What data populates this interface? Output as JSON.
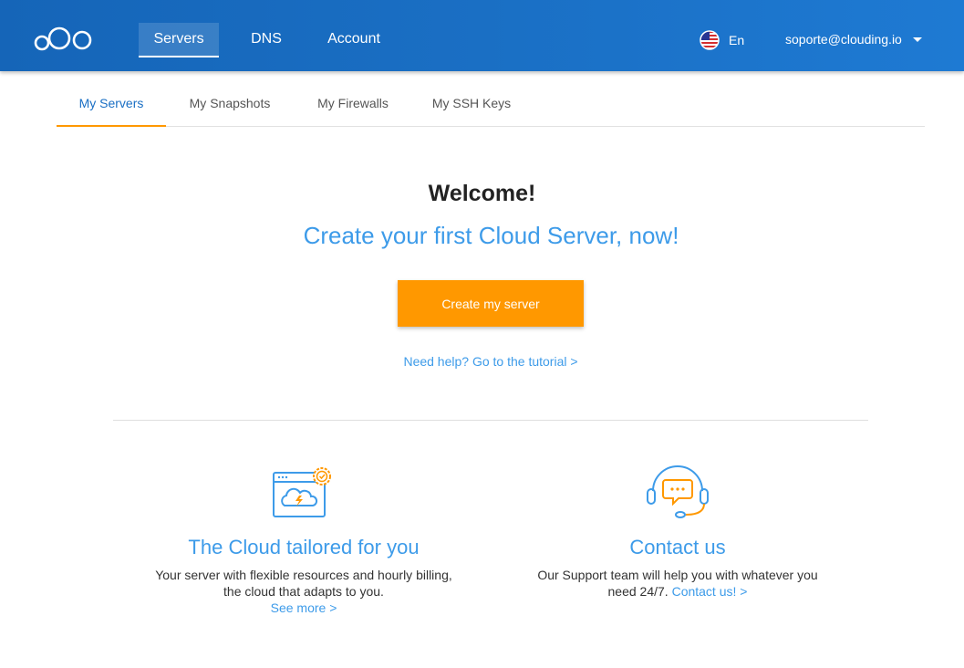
{
  "header": {
    "logo": "cloud-logo-icon",
    "nav": [
      {
        "label": "Servers",
        "active": true
      },
      {
        "label": "DNS",
        "active": false
      },
      {
        "label": "Account",
        "active": false
      }
    ],
    "language": {
      "flag": "us-flag-icon",
      "label": "En"
    },
    "user": {
      "email": "soporte@clouding.io"
    }
  },
  "tabs": [
    {
      "label": "My Servers",
      "active": true
    },
    {
      "label": "My Snapshots",
      "active": false
    },
    {
      "label": "My Firewalls",
      "active": false
    },
    {
      "label": "My SSH Keys",
      "active": false
    }
  ],
  "main": {
    "title": "Welcome!",
    "subtitle": "Create your first Cloud Server, now!",
    "cta_label": "Create my server",
    "help_link": "Need help? Go to the tutorial >"
  },
  "features": [
    {
      "icon": "cloud-window-icon",
      "title": "The Cloud tailored for you",
      "text": "Your server with flexible resources and hourly billing, the cloud that adapts to you.",
      "link": "See more >"
    },
    {
      "icon": "support-headset-icon",
      "title": "Contact us",
      "text": "Our Support team will help you with whatever you need 24/7.",
      "link": "Contact us! >"
    }
  ],
  "colors": {
    "header_bg": "#1a6fc4",
    "accent_blue": "#3d9be9",
    "accent_orange": "#ff9800"
  }
}
